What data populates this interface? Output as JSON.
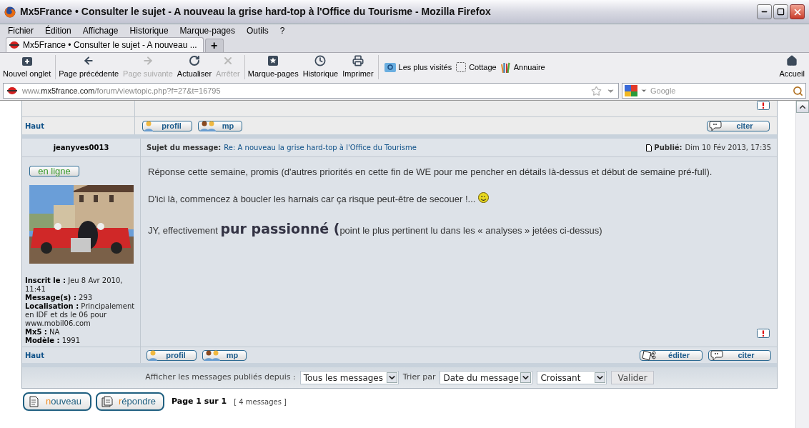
{
  "window": {
    "title": "Mx5France • Consulter le sujet - A nouveau la grise hard-top à l'Office du Tourisme - Mozilla Firefox"
  },
  "menu": [
    "Fichier",
    "Édition",
    "Affichage",
    "Historique",
    "Marque-pages",
    "Outils",
    "?"
  ],
  "tabs": [
    {
      "label": "Mx5France • Consulter le sujet - A nouveau ...",
      "selected": true
    }
  ],
  "new_tab": "+",
  "toolbar_groups": [
    [
      {
        "label": "Nouvel onglet",
        "kind": "newtab",
        "disabled": false
      }
    ],
    [
      {
        "label": "Page précédente",
        "kind": "back",
        "disabled": false
      },
      {
        "label": "Page suivante",
        "kind": "forward",
        "disabled": true
      },
      {
        "label": "Actualiser",
        "kind": "reload",
        "disabled": false
      },
      {
        "label": "Arrêter",
        "kind": "stop",
        "disabled": true
      }
    ],
    [
      {
        "label": "Marque-pages",
        "kind": "bookmarks",
        "disabled": false
      },
      {
        "label": "Historique",
        "kind": "history",
        "disabled": false
      },
      {
        "label": "Imprimer",
        "kind": "print",
        "disabled": false
      }
    ]
  ],
  "bookmarks": [
    {
      "label": "Les plus visités",
      "kind": "folder"
    },
    {
      "label": "Cottage",
      "kind": "blank"
    },
    {
      "label": "Annuaire",
      "kind": "bars"
    }
  ],
  "home": {
    "label": "Accueil"
  },
  "address": {
    "prefix": "www.",
    "domain": "mx5france.com",
    "path": "/forum/viewtopic.php?f=27&t=16795"
  },
  "search": {
    "placeholder": "Google"
  },
  "previous_footer": {
    "top_link": "Haut",
    "buttons": [
      {
        "label": "profil",
        "kind": "profile"
      },
      {
        "label": "mp",
        "kind": "pm"
      }
    ],
    "right_buttons": [
      {
        "label": "citer",
        "kind": "quote"
      }
    ]
  },
  "post": {
    "author": "jeanyves0013",
    "subject_label": "Sujet du message:",
    "subject": "Re: A nouveau la grise hard-top à l'Office du Tourisme",
    "posted_label": "Publié:",
    "posted": "Dim 10 Fév 2013, 17:35",
    "status": {
      "label": "en ligne",
      "online": true
    },
    "avatar": {
      "kind": "picture"
    },
    "profile": [
      {
        "label": "Inscrit le :",
        "value": "Jeu 8 Avr 2010, 11:41"
      },
      {
        "label": "Message(s) :",
        "value": "293"
      },
      {
        "label": "Localisation :",
        "value": "Principalement en IDF et ds le 06 pour www.mobil06.com"
      },
      {
        "label": "Mx5 :",
        "value": "NA"
      },
      {
        "label": "Modèle :",
        "value": "1991"
      }
    ],
    "paragraphs": [
      [
        {
          "kind": "plain",
          "text": "Réponse cette semaine, promis (d'autres priorités en cette fin de WE pour me pencher en détails là-dessus et début de semaine pré-full)."
        }
      ],
      [
        {
          "kind": "plain",
          "text": "D'ici là, commencez à boucler les harnais car ça risque peut-être de secouer !..."
        },
        {
          "kind": "smiley"
        }
      ],
      [
        {
          "kind": "plain",
          "text": "JY, effectivement "
        },
        {
          "kind": "large",
          "text": "pur passionné ("
        },
        {
          "kind": "plain",
          "text": "point le plus pertinent lu dans les « analyses » jetées ci-dessus)"
        }
      ]
    ],
    "footer": {
      "top_link": "Haut",
      "buttons": [
        {
          "label": "profil",
          "kind": "profile"
        },
        {
          "label": "mp",
          "kind": "pm"
        }
      ],
      "right_buttons": [
        {
          "label": "éditer",
          "kind": "edit"
        },
        {
          "label": "citer",
          "kind": "quote"
        }
      ]
    }
  },
  "sort_bar": {
    "label": "Afficher les messages publiés depuis :",
    "since": "Tous les messages",
    "sort_label": "Trier par",
    "sort_by": "Date du message",
    "order": "Croissant",
    "submit": "Valider"
  },
  "actions": [
    {
      "label": "nouveau",
      "kind": "new"
    },
    {
      "label": "répondre",
      "kind": "reply"
    }
  ],
  "pagination": {
    "page": "Page 1 sur 1",
    "count": "[ 4 messages ]"
  }
}
